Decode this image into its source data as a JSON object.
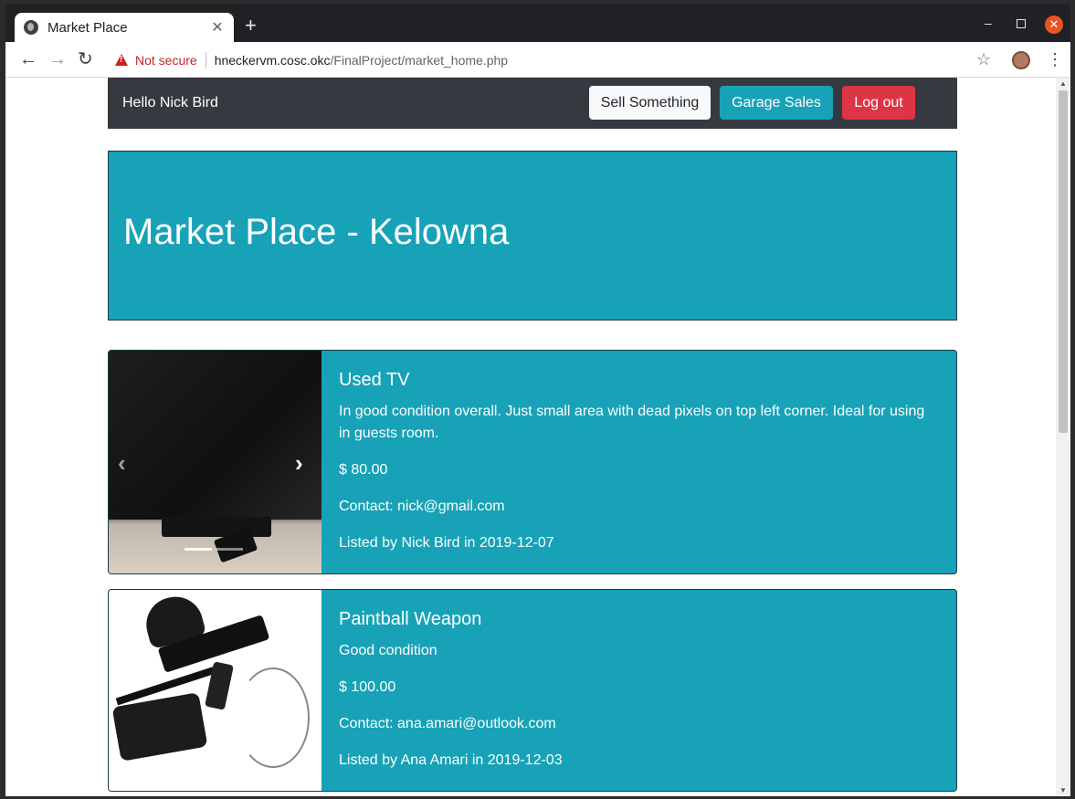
{
  "browser": {
    "tab_title": "Market Place",
    "close_glyph": "✕",
    "new_tab_glyph": "+",
    "security_label": "Not secure",
    "url_host": "hneckervm.cosc.okc",
    "url_path": "/FinalProject/market_home.php"
  },
  "nav": {
    "greeting": "Hello Nick Bird",
    "sell_label": "Sell Something",
    "garage_label": "Garage Sales",
    "logout_label": "Log out"
  },
  "jumbotron": {
    "title": "Market Place - Kelowna"
  },
  "listings": [
    {
      "title": "Used TV",
      "description": "In good condition overall. Just small area with dead pixels on top left corner. Ideal for using in guests room.",
      "price": "$ 80.00",
      "contact": "Contact: nick@gmail.com",
      "listed": "Listed by Nick Bird in 2019-12-07"
    },
    {
      "title": "Paintball Weapon",
      "description": "Good condition",
      "price": "$ 100.00",
      "contact": "Contact: ana.amari@outlook.com",
      "listed": "Listed by Ana Amari in 2019-12-03"
    }
  ],
  "colors": {
    "nav_bg": "#343a40",
    "accent": "#17a2b8",
    "danger": "#dc3545",
    "light": "#f8f9fa"
  }
}
